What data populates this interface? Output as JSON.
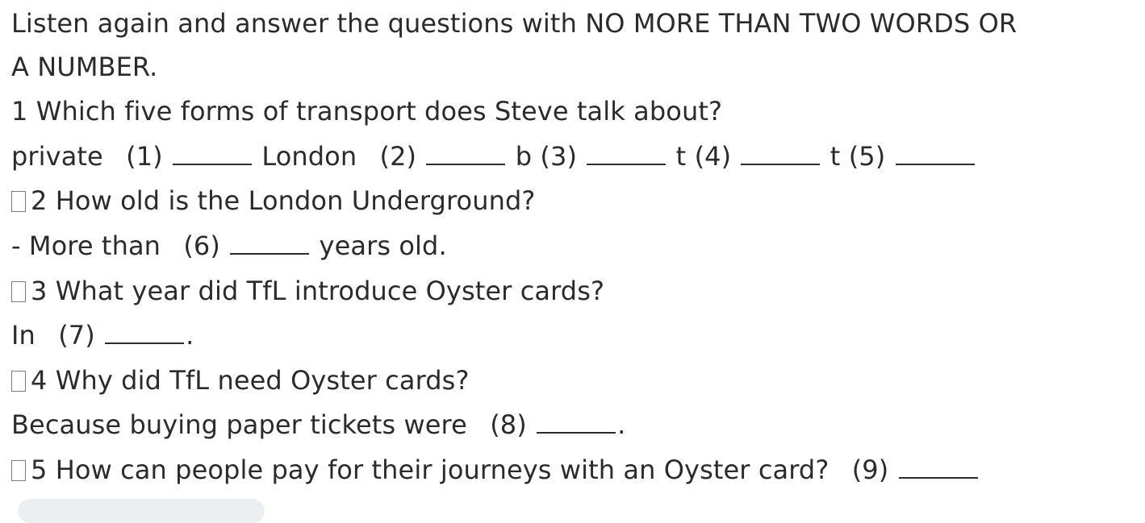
{
  "instruction": {
    "line1": "Listen again and answer the questions with NO MORE THAN TWO WORDS OR",
    "line2": "A NUMBER."
  },
  "q1": {
    "question": "1 Which five forms of transport does Steve talk about?",
    "answer_parts": {
      "p1": "private",
      "n1": "(1)",
      "p2": "London",
      "n2": "(2)",
      "p3": "b",
      "n3": "(3)",
      "p4": "t",
      "n4": "(4)",
      "p5": "t",
      "n5": "(5)"
    }
  },
  "q2": {
    "question": "2 How old is the London Underground?",
    "prefix": "- More than",
    "num": "(6)",
    "suffix": "years old."
  },
  "q3": {
    "question": "3 What year did TfL introduce Oyster cards?",
    "prefix": "In",
    "num": "(7)",
    "suffix": "."
  },
  "q4": {
    "question": "4 Why did TfL need Oyster cards?",
    "prefix": "Because buying paper tickets were",
    "num": "(8)",
    "suffix": "."
  },
  "q5": {
    "question": "5 How can people pay for their journeys with an Oyster card?",
    "num": "(9)"
  }
}
